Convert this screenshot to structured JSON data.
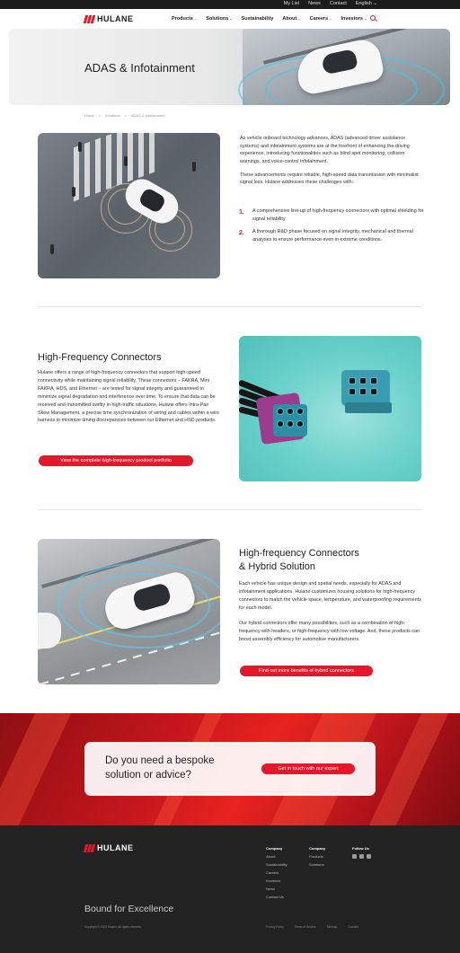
{
  "utility_bar": {
    "links": [
      "My List",
      "News",
      "Contact",
      "English"
    ]
  },
  "nav": {
    "logo": "HULANE",
    "menu": [
      "Products",
      "Solutions",
      "Sustainability",
      "About",
      "Careers",
      "Investors"
    ]
  },
  "hero": {
    "title": "ADAS & Infotainment"
  },
  "breadcrumb": [
    "Home",
    "Solutions",
    "ADAS & Infotainment"
  ],
  "intro": {
    "paragraphs": [
      "As vehicle onboard technology advances, ADAS (advanced driver assistance systems) and infotainment systems are at the forefront of enhancing the driving experience, introducing functionalities such as blind spot monitoring, collision warnings, and voice-control infotainment.",
      "These advancements require reliable, high-speed data transmission with minimalist signal loss. Hulane addresses these challenges with:"
    ],
    "list": [
      {
        "num": "1.",
        "text": "A comprehensive line-up of high-frequency connectors with optimal shielding for signal reliability"
      },
      {
        "num": "2.",
        "text": "A thorough R&D phase focused on signal integrity, mechanical and thermal analyses to ensure performance even in extreme conditions."
      }
    ]
  },
  "section_hf": {
    "title": "High-Frequency Connectors",
    "body": "Hulane offers a range of high-frequency connectors that support high-speed connectivity while maintaining signal reliability. These connectors – FAKRA, Mini FAKRA, HDS, and Ethernet – are tested for signal integrity and guaranteed to minimize signal degradation and interference over time. To ensure that data can be received and transmitted swiftly in high-traffic situations, Hulane offers Intra-Pair Skew Management, a precise time synchronization of wiring and cables within a wire harness to minimize timing discrepancies between our Ethernet and HSD products.",
    "cta": "View the complete high-frequency product portfolio"
  },
  "section_hybrid": {
    "title_line1": "High-frequency Connectors",
    "title_line2": "& Hybrid Solution",
    "para1": "Each vehicle has unique design and spatial needs, especially for ADAS and infotainment applications. Hulane customizes housing solutions for high-frequency connectors to match the vehicle space, temperature, and waterproofing requirements for each model.",
    "para2": "Our hybrid connectors offer many possibilities, such as a combination of high-frequency with headers, or high-frequency with low voltage. And, these products can boost assembly efficiency for automotive manufacturers.",
    "cta": "Find out more benefits of hybrid connectors"
  },
  "banner": {
    "question_line1": "Do you need a bespoke",
    "question_line2": "solution or advice?",
    "cta": "Get in touch with our expert"
  },
  "footer": {
    "logo": "HULANE",
    "company_col": {
      "head": "Company",
      "items": [
        "About",
        "Sustainability",
        "Careers",
        "Investors",
        "News",
        "Contact Us"
      ]
    },
    "products_col": {
      "head": "Company",
      "items": [
        "Products",
        "Solutions"
      ]
    },
    "follow_col": {
      "head": "Follow Us"
    },
    "slogan": "Bound for Excellence",
    "copyright": "Copyright © 2024 Hulane. All rights reserved.",
    "legal": [
      "Privacy Policy",
      "Terms of Service",
      "Sitemap",
      "Cookies"
    ]
  },
  "colors": {
    "accent": "#e4172b",
    "footer_bg": "#222222"
  }
}
